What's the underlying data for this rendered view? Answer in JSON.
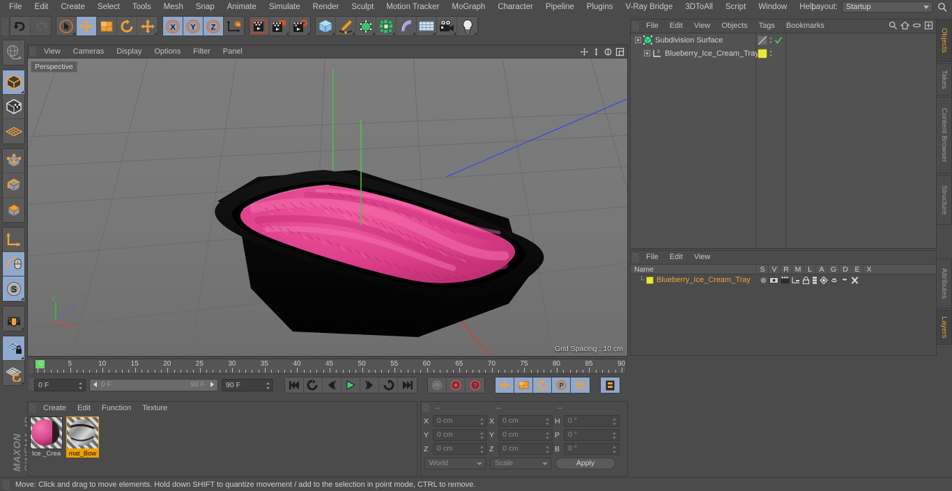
{
  "menubar": {
    "items": [
      "File",
      "Edit",
      "Create",
      "Select",
      "Tools",
      "Mesh",
      "Snap",
      "Animate",
      "Simulate",
      "Render",
      "Sculpt",
      "Motion Tracker",
      "MoGraph",
      "Character",
      "Pipeline",
      "Plugins",
      "V-Ray Bridge",
      "3DToAll",
      "Script",
      "Window",
      "Help"
    ],
    "layout_label": "Layout:",
    "layout_value": "Startup",
    "search_icon": "search-icon"
  },
  "toolbar": {
    "groups": [
      {
        "name": "undo-redo",
        "buttons": [
          {
            "name": "undo-button",
            "icon": "undo-icon",
            "active": false,
            "disabled": false,
            "corner": false
          },
          {
            "name": "redo-button",
            "icon": "redo-icon",
            "active": false,
            "disabled": true,
            "corner": false
          }
        ]
      },
      {
        "name": "transform-tools",
        "buttons": [
          {
            "name": "select-tool-button",
            "icon": "live-selection-icon",
            "active": false,
            "disabled": false,
            "corner": true
          },
          {
            "name": "move-tool-button",
            "icon": "move-icon",
            "active": true,
            "disabled": false,
            "corner": false
          },
          {
            "name": "scale-tool-button",
            "icon": "scale-icon",
            "active": false,
            "disabled": false,
            "corner": false
          },
          {
            "name": "rotate-tool-button",
            "icon": "rotate-icon",
            "active": false,
            "disabled": false,
            "corner": false
          },
          {
            "name": "active-tool-button",
            "icon": "move-icon",
            "active": false,
            "disabled": false,
            "corner": true
          }
        ]
      },
      {
        "name": "axis-locks",
        "buttons": [
          {
            "name": "lock-x-button",
            "icon": "axis-x-icon",
            "active": true,
            "disabled": false,
            "corner": false
          },
          {
            "name": "lock-y-button",
            "icon": "axis-y-icon",
            "active": true,
            "disabled": false,
            "corner": false
          },
          {
            "name": "lock-z-button",
            "icon": "axis-z-icon",
            "active": true,
            "disabled": false,
            "corner": false
          },
          {
            "name": "world-object-coord-button",
            "icon": "world-axis-icon",
            "active": false,
            "disabled": false,
            "corner": false
          }
        ]
      },
      {
        "name": "render-tools",
        "buttons": [
          {
            "name": "render-view-button",
            "icon": "render-view-icon",
            "active": false,
            "disabled": false,
            "corner": false
          },
          {
            "name": "render-region-button",
            "icon": "render-region-icon",
            "active": false,
            "disabled": false,
            "corner": true
          },
          {
            "name": "render-settings-button",
            "icon": "render-settings-icon",
            "active": false,
            "disabled": false,
            "corner": true
          }
        ]
      },
      {
        "name": "create-objects",
        "buttons": [
          {
            "name": "add-cube-button",
            "icon": "cube-icon",
            "active": false,
            "disabled": false,
            "corner": true
          },
          {
            "name": "add-spline-button",
            "icon": "pen-spline-icon",
            "active": false,
            "disabled": false,
            "corner": true
          },
          {
            "name": "add-generator-button",
            "icon": "generator-icon",
            "active": false,
            "disabled": false,
            "corner": true
          },
          {
            "name": "add-array-button",
            "icon": "array-icon",
            "active": false,
            "disabled": false,
            "corner": true
          },
          {
            "name": "add-deformer-button",
            "icon": "bend-deformer-icon",
            "active": false,
            "disabled": false,
            "corner": true
          },
          {
            "name": "add-scene-button",
            "icon": "floor-scene-icon",
            "active": false,
            "disabled": false,
            "corner": true
          },
          {
            "name": "add-camera-button",
            "icon": "camera-icon",
            "active": false,
            "disabled": false,
            "corner": true
          },
          {
            "name": "add-light-button",
            "icon": "light-bulb-icon",
            "active": false,
            "disabled": false,
            "corner": true
          }
        ]
      }
    ]
  },
  "leftbar": {
    "groups": [
      {
        "name": "undo-view-group",
        "buttons": [
          {
            "name": "undo-view-button",
            "icon": "undo-view-icon",
            "active": false,
            "corner": false
          }
        ]
      },
      {
        "name": "mode-group",
        "buttons": [
          {
            "name": "model-mode-button",
            "icon": "model-mode-icon",
            "active": true,
            "corner": true
          },
          {
            "name": "texture-mode-button",
            "icon": "texture-mode-icon",
            "active": false,
            "corner": false
          },
          {
            "name": "workplane-mode-button",
            "icon": "workplane-icon",
            "active": false,
            "corner": false
          }
        ]
      },
      {
        "name": "component-group",
        "buttons": [
          {
            "name": "points-mode-button",
            "icon": "points-mode-icon",
            "active": false,
            "corner": false
          },
          {
            "name": "edges-mode-button",
            "icon": "edges-mode-icon",
            "active": false,
            "corner": false
          },
          {
            "name": "polygons-mode-button",
            "icon": "polygons-mode-icon",
            "active": false,
            "corner": false
          }
        ]
      },
      {
        "name": "axis-group",
        "buttons": [
          {
            "name": "enable-axis-button",
            "icon": "axis-modify-icon",
            "active": false,
            "corner": false
          },
          {
            "name": "viewport-solo-button",
            "icon": "mouse-viewport-icon",
            "active": true,
            "corner": false
          },
          {
            "name": "soft-selection-button",
            "icon": "soft-selection-icon",
            "active": true,
            "corner": true
          }
        ]
      },
      {
        "name": "snap-group",
        "buttons": [
          {
            "name": "magnet-tool-button",
            "icon": "magnet-icon",
            "active": false,
            "corner": true
          }
        ]
      },
      {
        "name": "workplane-group",
        "buttons": [
          {
            "name": "lock-workplane-button",
            "icon": "workplane-lock-icon",
            "active": true,
            "corner": true
          },
          {
            "name": "planar-workplane-button",
            "icon": "workplane-rotate-icon",
            "active": false,
            "corner": true
          }
        ]
      }
    ],
    "brand_top": "MAXON",
    "brand_bottom": "CINEMA 4D"
  },
  "viewport": {
    "menu": [
      "View",
      "Cameras",
      "Display",
      "Options",
      "Filter",
      "Panel"
    ],
    "nav_icons": [
      "pan-icon",
      "dolly-icon",
      "rotate-view-icon",
      "maximize-viewport-icon"
    ],
    "label": "Perspective",
    "grid_spacing": "Grid Spacing : 10 cm",
    "axis_gizmo": {
      "x": "X",
      "y": "Y",
      "z": "Z"
    },
    "model": {
      "name": "Blueberry_Ice_Cream_Tray",
      "tray_color": "#090909",
      "icecream_color": "#e0408a",
      "background_color": "#7a7a7a"
    }
  },
  "timeline": {
    "ticks": [
      "0",
      "5",
      "10",
      "15",
      "20",
      "25",
      "30",
      "35",
      "40",
      "45",
      "50",
      "55",
      "60",
      "65",
      "70",
      "75",
      "80",
      "85",
      "90"
    ],
    "current_frame_field": "0 F",
    "current_frame_right": "0 F",
    "range_start": "0 F",
    "range_end": "90 F",
    "end_frame_field": "90 F",
    "transport": [
      {
        "name": "go-to-start-button",
        "icon": "skip-start-icon",
        "active": false
      },
      {
        "name": "previous-keyframe-button",
        "icon": "prev-key-icon",
        "active": false
      },
      {
        "name": "step-back-button",
        "icon": "step-back-icon",
        "active": false
      },
      {
        "name": "play-button",
        "icon": "play-icon",
        "active": false
      },
      {
        "name": "step-forward-button",
        "icon": "step-forward-icon",
        "active": false
      },
      {
        "name": "next-keyframe-button",
        "icon": "next-key-icon",
        "active": false
      },
      {
        "name": "go-to-end-button",
        "icon": "skip-end-icon",
        "active": false
      }
    ],
    "record_group": [
      {
        "name": "autokey-button",
        "icon": "autokey-icon",
        "active": false
      },
      {
        "name": "record-active-objects-button",
        "icon": "record-icon",
        "active": false
      },
      {
        "name": "keyframe-selection-button",
        "icon": "key-selection-icon",
        "active": false
      }
    ],
    "param_group": [
      {
        "name": "record-position-button",
        "icon": "position-key-icon",
        "active": true
      },
      {
        "name": "record-scale-button",
        "icon": "scale-key-icon",
        "active": true
      },
      {
        "name": "record-rotation-button",
        "icon": "rotation-key-icon",
        "active": true
      },
      {
        "name": "record-pla-button",
        "icon": "pla-key-icon",
        "active": true
      },
      {
        "name": "record-points-button",
        "icon": "point-level-icon",
        "active": true
      }
    ],
    "filmstrip_button": {
      "name": "timeline-settings-button",
      "icon": "filmstrip-icon",
      "active": true
    }
  },
  "material_manager": {
    "menu": [
      "Create",
      "Edit",
      "Function",
      "Texture"
    ],
    "materials": [
      {
        "name": "Ice _Crea",
        "selected": false,
        "color": "#d94f8c"
      },
      {
        "name": "mat_Bow",
        "selected": true,
        "color": "#9a9a9a"
      }
    ]
  },
  "coordinates": {
    "headers": [
      "--",
      "--",
      "--"
    ],
    "rows": [
      {
        "pos_label": "X",
        "pos_value": "0 cm",
        "size_label": "X",
        "size_value": "0 cm",
        "rot_label": "H",
        "rot_value": "0 °"
      },
      {
        "pos_label": "Y",
        "pos_value": "0 cm",
        "size_label": "Y",
        "size_value": "0 cm",
        "rot_label": "P",
        "rot_value": "0 °"
      },
      {
        "pos_label": "Z",
        "pos_value": "0 cm",
        "size_label": "Z",
        "size_value": "0 cm",
        "rot_label": "B",
        "rot_value": "0 °"
      }
    ],
    "coord_system": "World",
    "mode": "Scale",
    "apply_label": "Apply"
  },
  "object_manager": {
    "menu": [
      "File",
      "Edit",
      "View",
      "Objects",
      "Tags",
      "Bookmarks"
    ],
    "header_icons": [
      "search-icon",
      "home-icon",
      "eye-icon",
      "expand-icon"
    ],
    "items": [
      {
        "name": "Subdivision Surface",
        "icon": "subdivision-surface-icon",
        "indent": 0,
        "tag_color": "none",
        "checked": true
      },
      {
        "name": "Blueberry_Ice_Cream_Tray",
        "icon": "polygon-object-icon",
        "indent": 1,
        "tag_color": "#e8e83c",
        "checked": false
      }
    ]
  },
  "layer_manager": {
    "menu": [
      "File",
      "Edit",
      "View"
    ],
    "columns": [
      "Name",
      "S",
      "V",
      "R",
      "M",
      "L",
      "A",
      "G",
      "D",
      "E",
      "X"
    ],
    "rows": [
      {
        "name": "Blueberry_Ice_Cream_Tray",
        "color": "#e8e83c"
      }
    ]
  },
  "right_tabs": {
    "top": [
      {
        "label": "Objects",
        "active": true
      },
      {
        "label": "Takes",
        "active": false
      },
      {
        "label": "Content Browser",
        "active": false
      },
      {
        "label": "Structure",
        "active": false
      }
    ],
    "bottom": [
      {
        "label": "Attributes",
        "active": false
      },
      {
        "label": "Layers",
        "active": true
      }
    ]
  },
  "statusbar": {
    "message": "Move: Click and drag to move elements. Hold down SHIFT to quantize movement / add to the selection in point mode, CTRL to remove."
  },
  "colors": {
    "accent_orange": "#e8a23c",
    "active_blue": "#8fa8cc",
    "panel_bg": "#4b4b4b",
    "viewport_bg": "#7a7a7a",
    "icecream_pink": "#e0408a"
  }
}
